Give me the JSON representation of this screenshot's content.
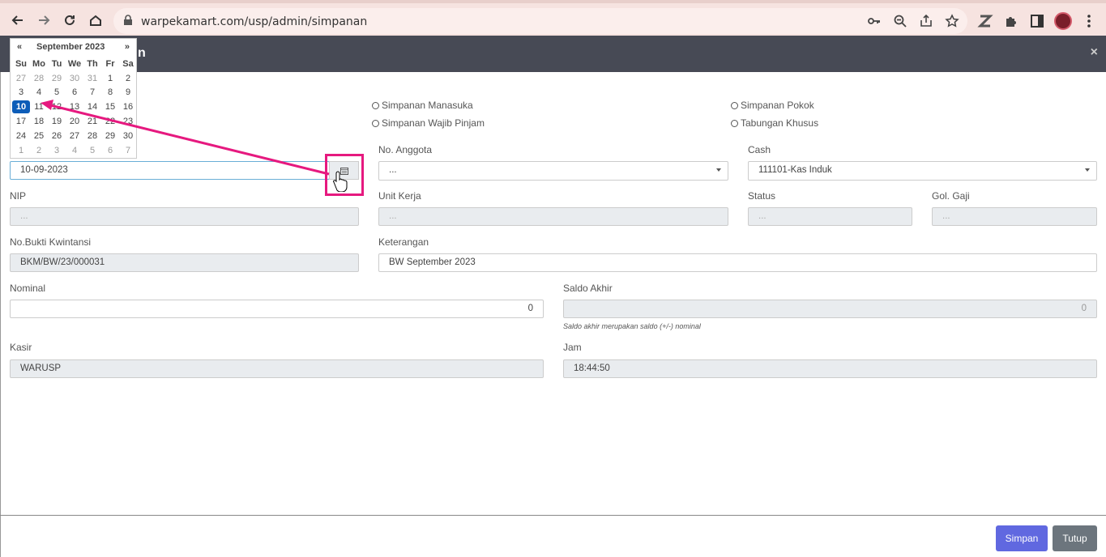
{
  "browser": {
    "url": "warpekamart.com/usp/admin/simpanan",
    "back_icon": "arrow-left-icon",
    "forward_icon": "arrow-right-icon",
    "reload_icon": "reload-icon",
    "home_icon": "home-icon"
  },
  "modal": {
    "title_fragment": "n",
    "close": "×"
  },
  "datepicker": {
    "prev": "«",
    "title": "September 2023",
    "next": "»",
    "dow": [
      "Su",
      "Mo",
      "Tu",
      "We",
      "Th",
      "Fr",
      "Sa"
    ],
    "weeks": [
      [
        "27",
        "28",
        "29",
        "30",
        "31",
        "1",
        "2"
      ],
      [
        "3",
        "4",
        "5",
        "6",
        "7",
        "8",
        "9"
      ],
      [
        "10",
        "11",
        "12",
        "13",
        "14",
        "15",
        "16"
      ],
      [
        "17",
        "18",
        "19",
        "20",
        "21",
        "22",
        "23"
      ],
      [
        "24",
        "25",
        "26",
        "27",
        "28",
        "29",
        "30"
      ],
      [
        "1",
        "2",
        "3",
        "4",
        "5",
        "6",
        "7"
      ]
    ],
    "selected": "10"
  },
  "radios": {
    "manasuka": "Simpanan Manasuka",
    "wajib_pinjam": "Simpanan Wajib Pinjam",
    "pokok": "Simpanan Pokok",
    "tabungan": "Tabungan Khusus"
  },
  "form": {
    "tanggal_value": "10-09-2023",
    "no_anggota_label": "No. Anggota",
    "no_anggota_value": "...",
    "cash_label": "Cash",
    "cash_value": "111101-Kas Induk",
    "nip_label": "NIP",
    "nip_ph": "...",
    "unit_kerja_label": "Unit Kerja",
    "unit_kerja_ph": "...",
    "status_label": "Status",
    "status_ph": "...",
    "gol_gaji_label": "Gol. Gaji",
    "gol_gaji_ph": "...",
    "bukti_label": "No.Bukti Kwintansi",
    "bukti_value": "BKM/BW/23/000031",
    "keterangan_label": "Keterangan",
    "keterangan_value": "BW September 2023",
    "nominal_label": "Nominal",
    "nominal_value": "0",
    "saldo_label": "Saldo Akhir",
    "saldo_value": "0",
    "saldo_help": "Saldo akhir merupakan saldo (+/-) nominal",
    "kasir_label": "Kasir",
    "kasir_value": "WARUSP",
    "jam_label": "Jam",
    "jam_value": "18:44:50"
  },
  "buttons": {
    "simpan": "Simpan",
    "tutup": "Tutup"
  },
  "colors": {
    "annotation": "#e6197f",
    "primary": "#6068e0",
    "secondary": "#6c757d",
    "selected_day": "#0d5db8"
  }
}
